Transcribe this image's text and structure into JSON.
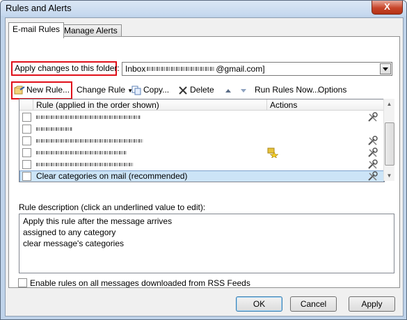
{
  "window": {
    "title": "Rules and Alerts",
    "close_glyph": "X"
  },
  "tabs": [
    {
      "label": "E-mail Rules"
    },
    {
      "label": "Manage Alerts"
    }
  ],
  "folder": {
    "label": "Apply changes to this folder:",
    "value_prefix": "Inbox",
    "value_suffix": "@gmail.com]"
  },
  "toolbar": {
    "new_rule": "New Rule...",
    "change_rule": "Change Rule",
    "copy": "Copy...",
    "delete": "Delete",
    "run_rules": "Run Rules Now...",
    "options": "Options"
  },
  "rules_list": {
    "col_rule": "Rule (applied in the order shown)",
    "col_actions": "Actions",
    "last_rule": "Clear categories on mail (recommended)"
  },
  "description": {
    "label": "Rule description (click an underlined value to edit):",
    "lines": [
      "Apply this rule after the message arrives",
      "assigned to any category",
      "clear message's categories"
    ]
  },
  "rss": {
    "label": "Enable rules on all messages downloaded from RSS Feeds"
  },
  "buttons": {
    "ok": "OK",
    "cancel": "Cancel",
    "apply": "Apply"
  },
  "colors": {
    "highlight": "#e0101a",
    "selection": "#cce4f7"
  }
}
